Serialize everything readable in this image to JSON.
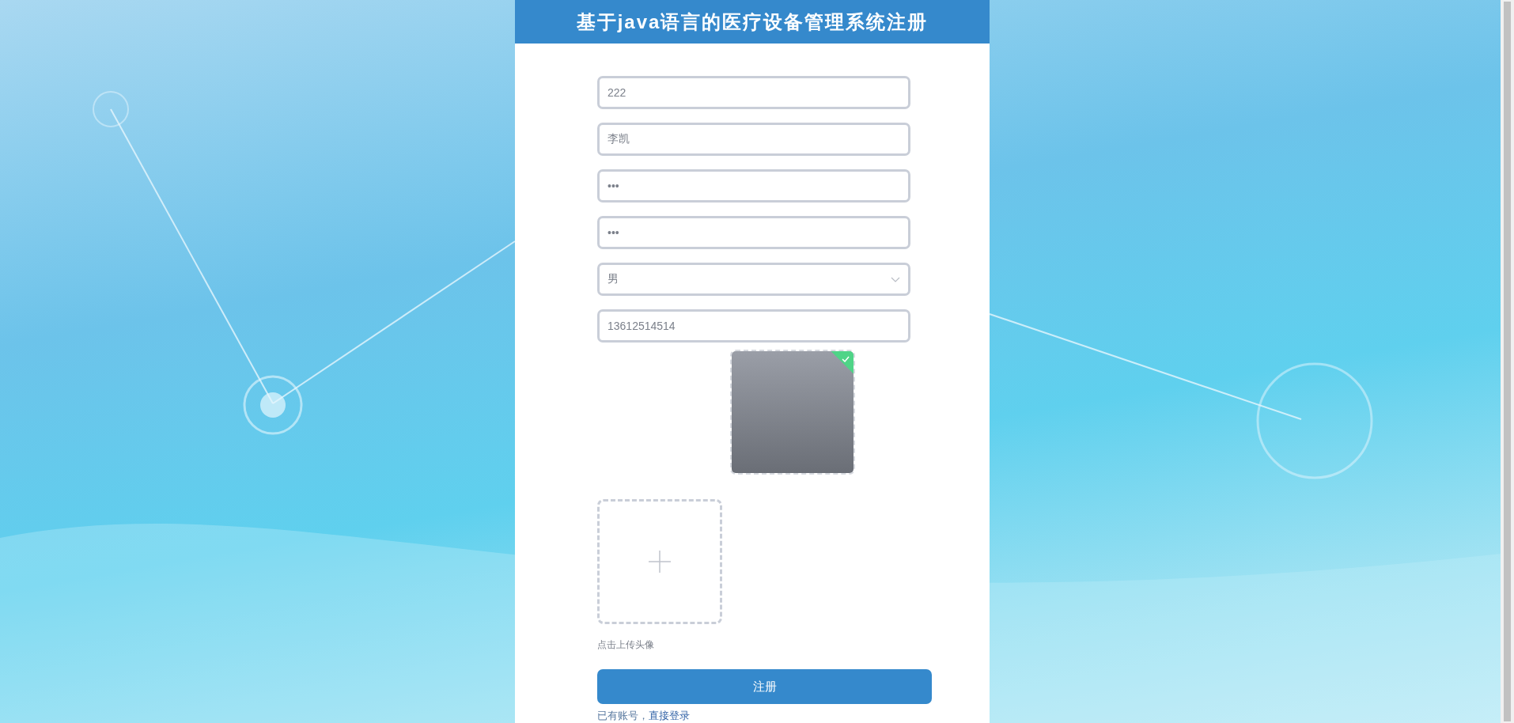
{
  "title": "基于java语言的医疗设备管理系统注册",
  "fields": [
    {
      "kind": "text",
      "value": "222"
    },
    {
      "kind": "text",
      "value": "李凯"
    },
    {
      "kind": "text",
      "value": "•••"
    },
    {
      "kind": "text",
      "value": "•••"
    },
    {
      "kind": "select",
      "value": "男"
    },
    {
      "kind": "text",
      "value": "13612514514"
    }
  ],
  "avatar_preview": {
    "uploaded": true
  },
  "upload": {
    "caption": "点击上传头像"
  },
  "submit": "注册",
  "footer": {
    "text": "已有账号，",
    "link": "直接登录"
  }
}
